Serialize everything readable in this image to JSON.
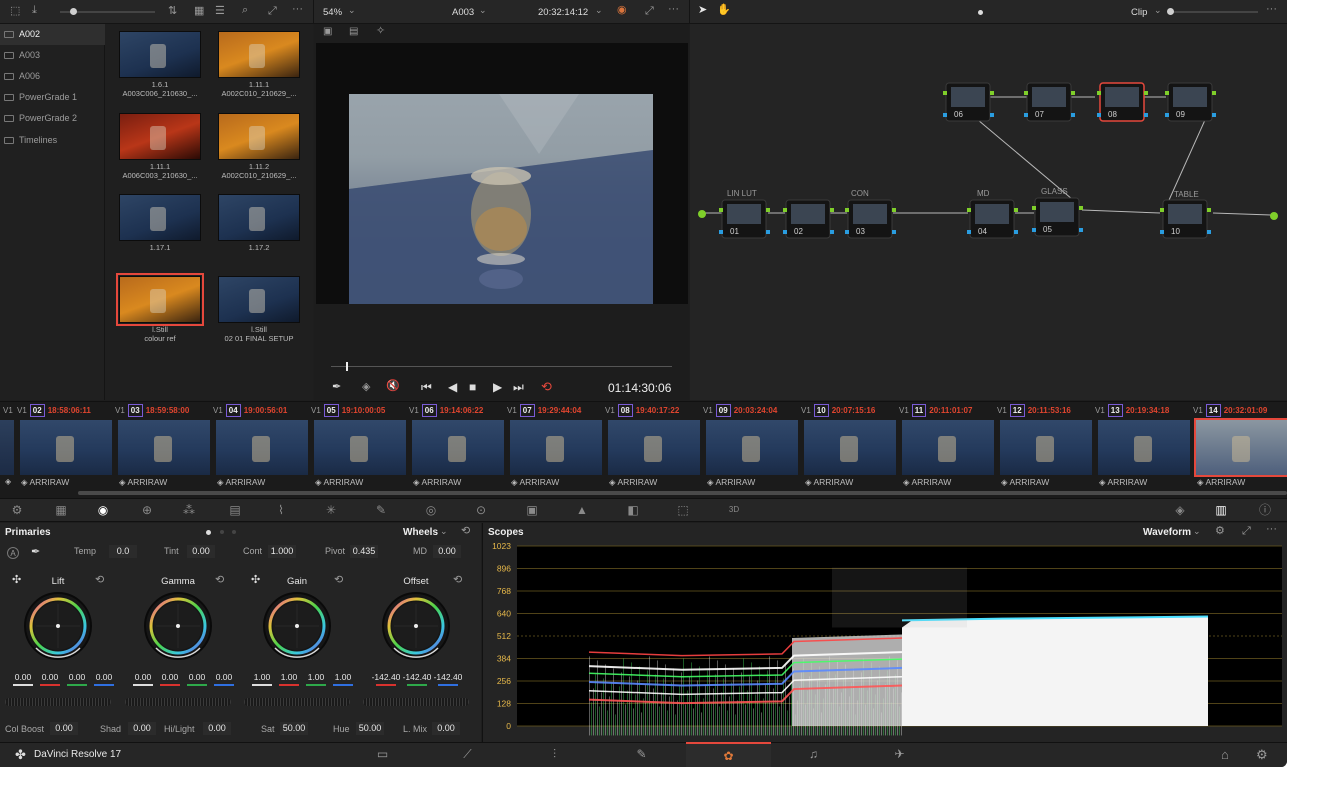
{
  "app": {
    "name": "DaVinci Resolve 17"
  },
  "viewer": {
    "zoom": "54%",
    "clip_name": "A003",
    "timecode": "20:32:14:12",
    "playhead_tc": "01:14:30:06"
  },
  "gallery": {
    "albums": [
      {
        "label": "A002",
        "active": true
      },
      {
        "label": "A003",
        "active": false
      },
      {
        "label": "A006",
        "active": false
      },
      {
        "label": "PowerGrade 1",
        "active": false
      },
      {
        "label": "PowerGrade 2",
        "active": false
      },
      {
        "label": "Timelines",
        "active": false
      }
    ],
    "stills": [
      {
        "line1": "1.6.1",
        "line2": "A003C006_210630_...",
        "tone": "blue",
        "selected": false
      },
      {
        "line1": "1.11.1",
        "line2": "A002C010_210629_...",
        "tone": "orange",
        "selected": false
      },
      {
        "line1": "1.11.1",
        "line2": "A006C003_210630_...",
        "tone": "red",
        "selected": false
      },
      {
        "line1": "1.11.2",
        "line2": "A002C010_210629_...",
        "tone": "orange",
        "selected": false
      },
      {
        "line1": "1.17.1",
        "line2": "",
        "tone": "blue",
        "selected": false
      },
      {
        "line1": "1.17.2",
        "line2": "",
        "tone": "blue",
        "selected": false
      },
      {
        "line1": "l.Still",
        "line2": "colour ref",
        "tone": "orange",
        "selected": true
      },
      {
        "line1": "l.Still",
        "line2": "02 01 FINAL SETUP",
        "tone": "blue",
        "selected": false
      }
    ]
  },
  "node_graph": {
    "mode": "Clip",
    "labels": {
      "n01": "LIN LUT",
      "n03": "CON",
      "n04": "MD",
      "n05": "GLASS",
      "n10": "TABLE"
    },
    "nodes": [
      "06",
      "07",
      "08",
      "09",
      "01",
      "02",
      "03",
      "04",
      "05",
      "10"
    ]
  },
  "timeline": {
    "clips": [
      {
        "track": "V1",
        "num": "02",
        "tc": "18:58:06:11",
        "cam": "ARRIRAW",
        "selected": false
      },
      {
        "track": "V1",
        "num": "03",
        "tc": "18:59:58:00",
        "cam": "ARRIRAW",
        "selected": false
      },
      {
        "track": "V1",
        "num": "04",
        "tc": "19:00:56:01",
        "cam": "ARRIRAW",
        "selected": false
      },
      {
        "track": "V1",
        "num": "05",
        "tc": "19:10:00:05",
        "cam": "ARRIRAW",
        "selected": false
      },
      {
        "track": "V1",
        "num": "06",
        "tc": "19:14:06:22",
        "cam": "ARRIRAW",
        "selected": false
      },
      {
        "track": "V1",
        "num": "07",
        "tc": "19:29:44:04",
        "cam": "ARRIRAW",
        "selected": false
      },
      {
        "track": "V1",
        "num": "08",
        "tc": "19:40:17:22",
        "cam": "ARRIRAW",
        "selected": false
      },
      {
        "track": "V1",
        "num": "09",
        "tc": "20:03:24:04",
        "cam": "ARRIRAW",
        "selected": false
      },
      {
        "track": "V1",
        "num": "10",
        "tc": "20:07:15:16",
        "cam": "ARRIRAW",
        "selected": false
      },
      {
        "track": "V1",
        "num": "11",
        "tc": "20:11:01:07",
        "cam": "ARRIRAW",
        "selected": false
      },
      {
        "track": "V1",
        "num": "12",
        "tc": "20:11:53:16",
        "cam": "ARRIRAW",
        "selected": false
      },
      {
        "track": "V1",
        "num": "13",
        "tc": "20:19:34:18",
        "cam": "ARRIRAW",
        "selected": false
      },
      {
        "track": "V1",
        "num": "14",
        "tc": "20:32:01:09",
        "cam": "ARRIRAW",
        "selected": true
      }
    ]
  },
  "primaries": {
    "title": "Primaries",
    "mode": "Wheels",
    "top_row": [
      {
        "label": "Temp",
        "value": "0.0"
      },
      {
        "label": "Tint",
        "value": "0.00"
      },
      {
        "label": "Cont",
        "value": "1.000"
      },
      {
        "label": "Pivot",
        "value": "0.435"
      },
      {
        "label": "MD",
        "value": "0.00"
      }
    ],
    "wheels": [
      {
        "name": "Lift",
        "values": [
          "0.00",
          "0.00",
          "0.00",
          "0.00"
        ]
      },
      {
        "name": "Gamma",
        "values": [
          "0.00",
          "0.00",
          "0.00",
          "0.00"
        ]
      },
      {
        "name": "Gain",
        "values": [
          "1.00",
          "1.00",
          "1.00",
          "1.00"
        ]
      },
      {
        "name": "Offset",
        "values": [
          "-142.40",
          "-142.40",
          "-142.40"
        ]
      }
    ],
    "bottom_row": [
      {
        "label": "Col Boost",
        "value": "0.00"
      },
      {
        "label": "Shad",
        "value": "0.00"
      },
      {
        "label": "Hi/Light",
        "value": "0.00"
      },
      {
        "label": "Sat",
        "value": "50.00"
      },
      {
        "label": "Hue",
        "value": "50.00"
      },
      {
        "label": "L. Mix",
        "value": "0.00"
      }
    ]
  },
  "scopes": {
    "title": "Scopes",
    "mode": "Waveform",
    "y_ticks": [
      "1023",
      "896",
      "768",
      "640",
      "512",
      "384",
      "256",
      "128",
      "0"
    ]
  },
  "colors": {
    "accent_red": "#e5483c",
    "tc_red": "#e0452f",
    "bg": "#1e1e1e",
    "panel": "#262626"
  }
}
